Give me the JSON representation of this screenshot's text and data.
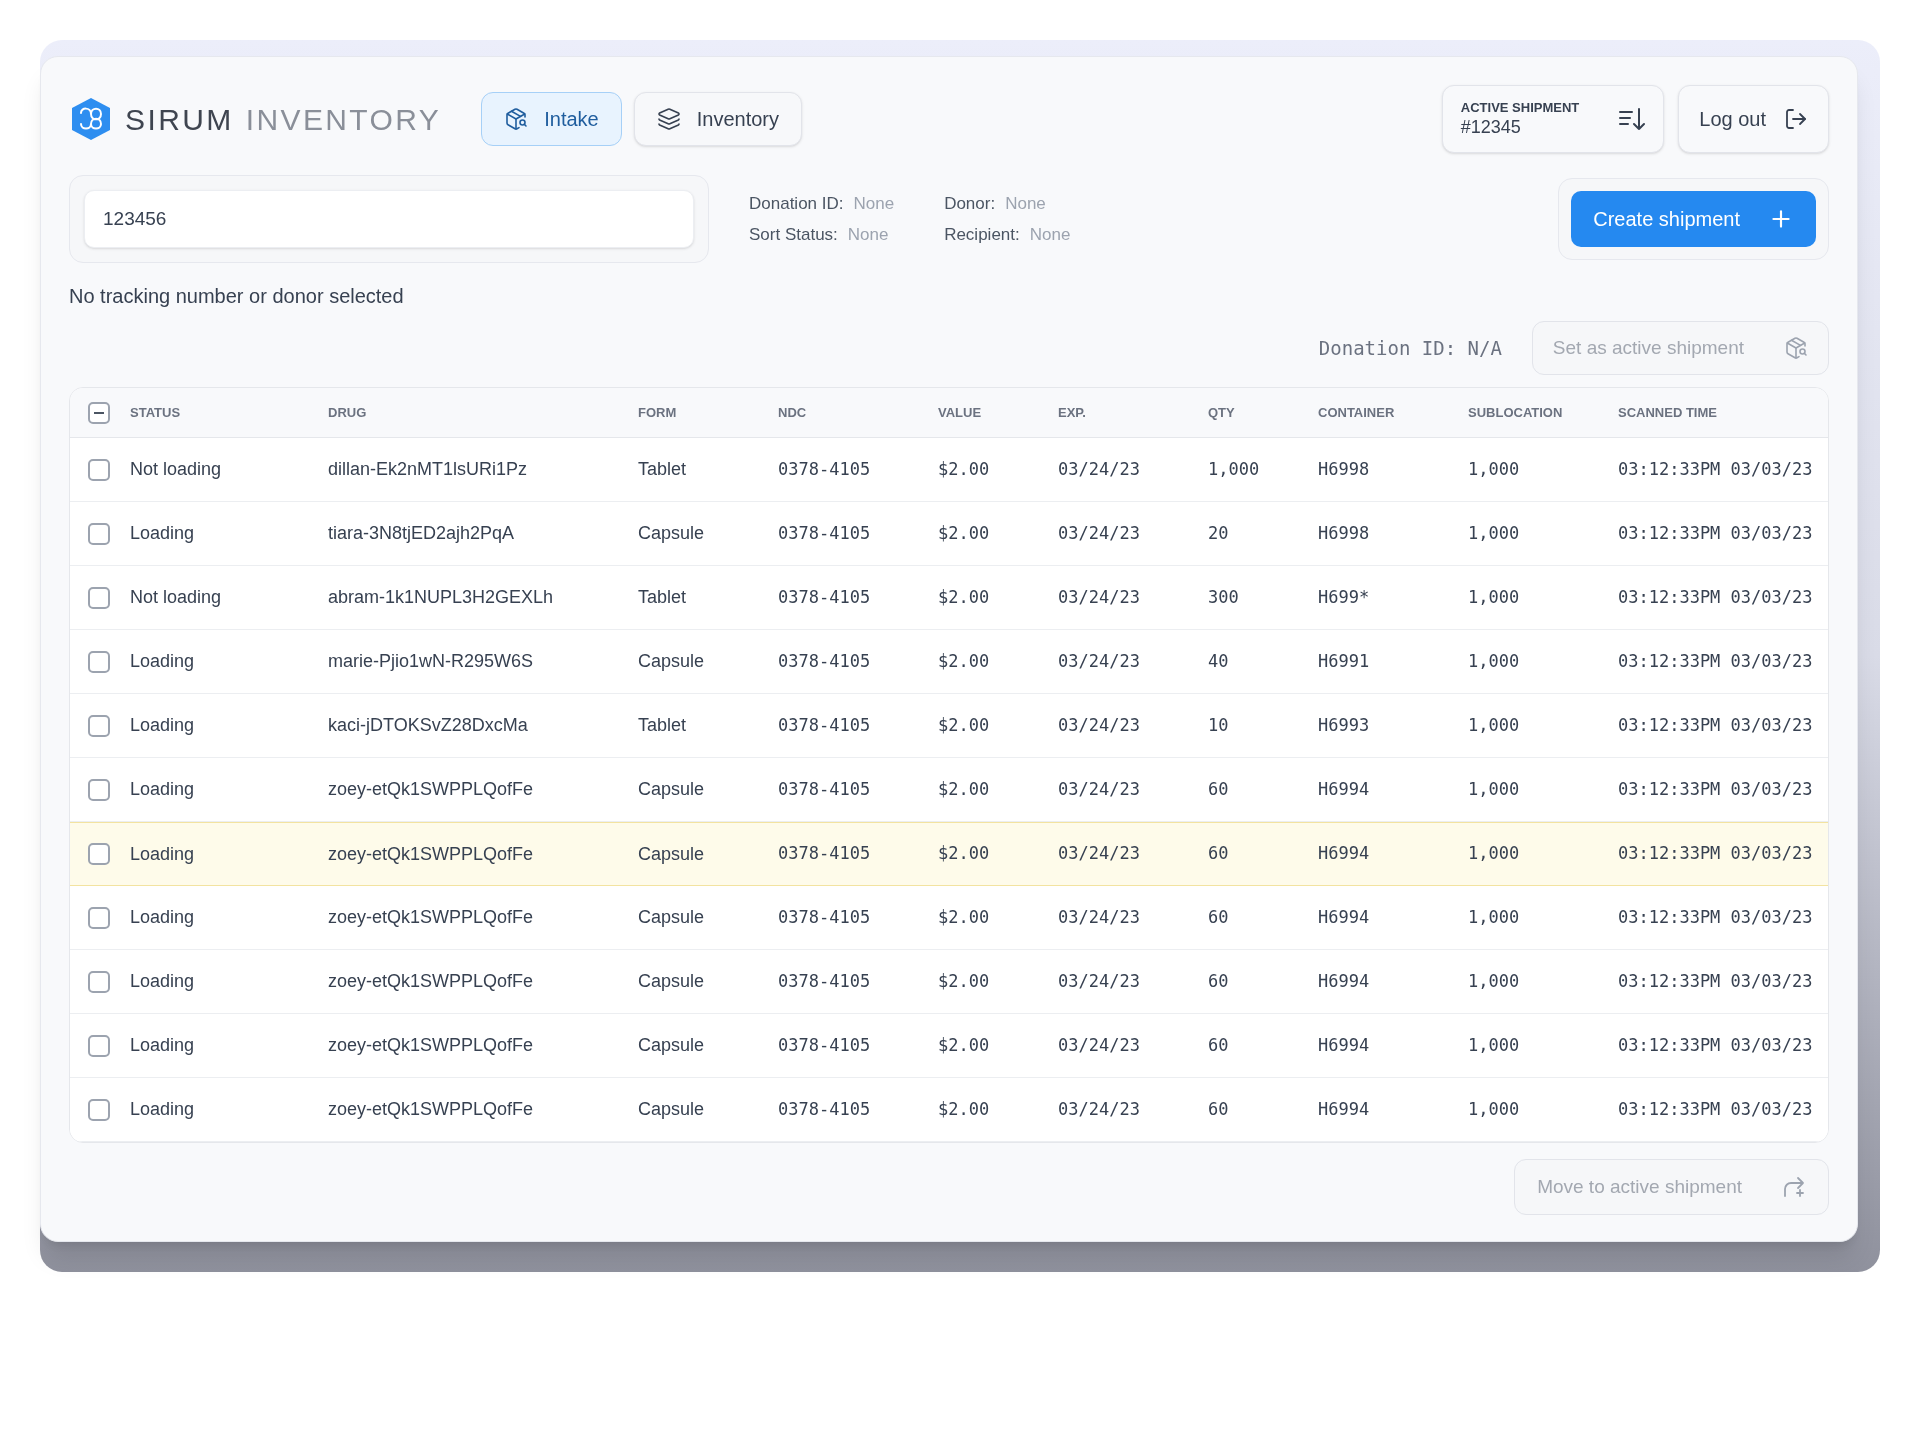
{
  "brand": {
    "name": "SIRUM",
    "product": "INVENTORY"
  },
  "tabs": [
    {
      "label": "Intake",
      "selected": true
    },
    {
      "label": "Inventory",
      "selected": false
    }
  ],
  "active_shipment": {
    "label": "ACTIVE SHIPMENT",
    "number": "#12345"
  },
  "logout_button": {
    "label": "Log out"
  },
  "tracking_field": {
    "value": "123456"
  },
  "details": [
    {
      "label": "Donation ID:",
      "value": "None"
    },
    {
      "label": "Sort Status:",
      "value": "None"
    },
    {
      "label": "Donor:",
      "value": "None"
    },
    {
      "label": "Recipient:",
      "value": "None"
    }
  ],
  "create_button": {
    "label": "Create shipment"
  },
  "status_message": "No tracking number or donor selected",
  "donation_id": "Donation ID: N/A",
  "set_active_button": {
    "label": "Set as active shipment",
    "disabled": true
  },
  "table": {
    "select_all": {
      "indeterminate": true
    },
    "columns": [
      "STATUS",
      "DRUG",
      "FORM",
      "NDC",
      "VALUE",
      "EXP.",
      "QTY",
      "CONTAINER",
      "SUBLOCATION",
      "SCANNED TIME"
    ],
    "rows": [
      {
        "checked": false,
        "selected": false,
        "cells": [
          "Not loading",
          "dillan-Ek2nMT1lsURi1Pz",
          "Tablet",
          "0378-4105",
          "$2.00",
          "03/24/23",
          "1,000",
          "H6998",
          "1,000",
          "03:12:33PM 03/03/23"
        ]
      },
      {
        "checked": false,
        "selected": false,
        "cells": [
          "Loading",
          "tiara-3N8tjED2ajh2PqA",
          "Capsule",
          "0378-4105",
          "$2.00",
          "03/24/23",
          "20",
          "H6998",
          "1,000",
          "03:12:33PM 03/03/23"
        ]
      },
      {
        "checked": false,
        "selected": false,
        "cells": [
          "Not loading",
          "abram-1k1NUPL3H2GEXLh",
          "Tablet",
          "0378-4105",
          "$2.00",
          "03/24/23",
          "300",
          "H699*",
          "1,000",
          "03:12:33PM 03/03/23"
        ]
      },
      {
        "checked": false,
        "selected": false,
        "cells": [
          "Loading",
          "marie-Pjio1wN-R295W6S",
          "Capsule",
          "0378-4105",
          "$2.00",
          "03/24/23",
          "40",
          "H6991",
          "1,000",
          "03:12:33PM 03/03/23"
        ]
      },
      {
        "checked": false,
        "selected": false,
        "cells": [
          "Loading",
          "kaci-jDTOKSvZ28DxcMa",
          "Tablet",
          "0378-4105",
          "$2.00",
          "03/24/23",
          "10",
          "H6993",
          "1,000",
          "03:12:33PM 03/03/23"
        ]
      },
      {
        "checked": false,
        "selected": false,
        "cells": [
          "Loading",
          "zoey-etQk1SWPPLQofFe",
          "Capsule",
          "0378-4105",
          "$2.00",
          "03/24/23",
          "60",
          "H6994",
          "1,000",
          "03:12:33PM 03/03/23"
        ]
      },
      {
        "checked": false,
        "selected": true,
        "cells": [
          "Loading",
          "zoey-etQk1SWPPLQofFe",
          "Capsule",
          "0378-4105",
          "$2.00",
          "03/24/23",
          "60",
          "H6994",
          "1,000",
          "03:12:33PM 03/03/23"
        ]
      },
      {
        "checked": false,
        "selected": false,
        "cells": [
          "Loading",
          "zoey-etQk1SWPPLQofFe",
          "Capsule",
          "0378-4105",
          "$2.00",
          "03/24/23",
          "60",
          "H6994",
          "1,000",
          "03:12:33PM 03/03/23"
        ]
      },
      {
        "checked": false,
        "selected": false,
        "cells": [
          "Loading",
          "zoey-etQk1SWPPLQofFe",
          "Capsule",
          "0378-4105",
          "$2.00",
          "03/24/23",
          "60",
          "H6994",
          "1,000",
          "03:12:33PM 03/03/23"
        ]
      },
      {
        "checked": false,
        "selected": false,
        "cells": [
          "Loading",
          "zoey-etQk1SWPPLQofFe",
          "Capsule",
          "0378-4105",
          "$2.00",
          "03/24/23",
          "60",
          "H6994",
          "1,000",
          "03:12:33PM 03/03/23"
        ]
      },
      {
        "checked": false,
        "selected": false,
        "cells": [
          "Loading",
          "zoey-etQk1SWPPLQofFe",
          "Capsule",
          "0378-4105",
          "$2.00",
          "03/24/23",
          "60",
          "H6994",
          "1,000",
          "03:12:33PM 03/03/23"
        ]
      }
    ]
  },
  "move_button": {
    "label": "Move to active shipment",
    "disabled": true
  }
}
